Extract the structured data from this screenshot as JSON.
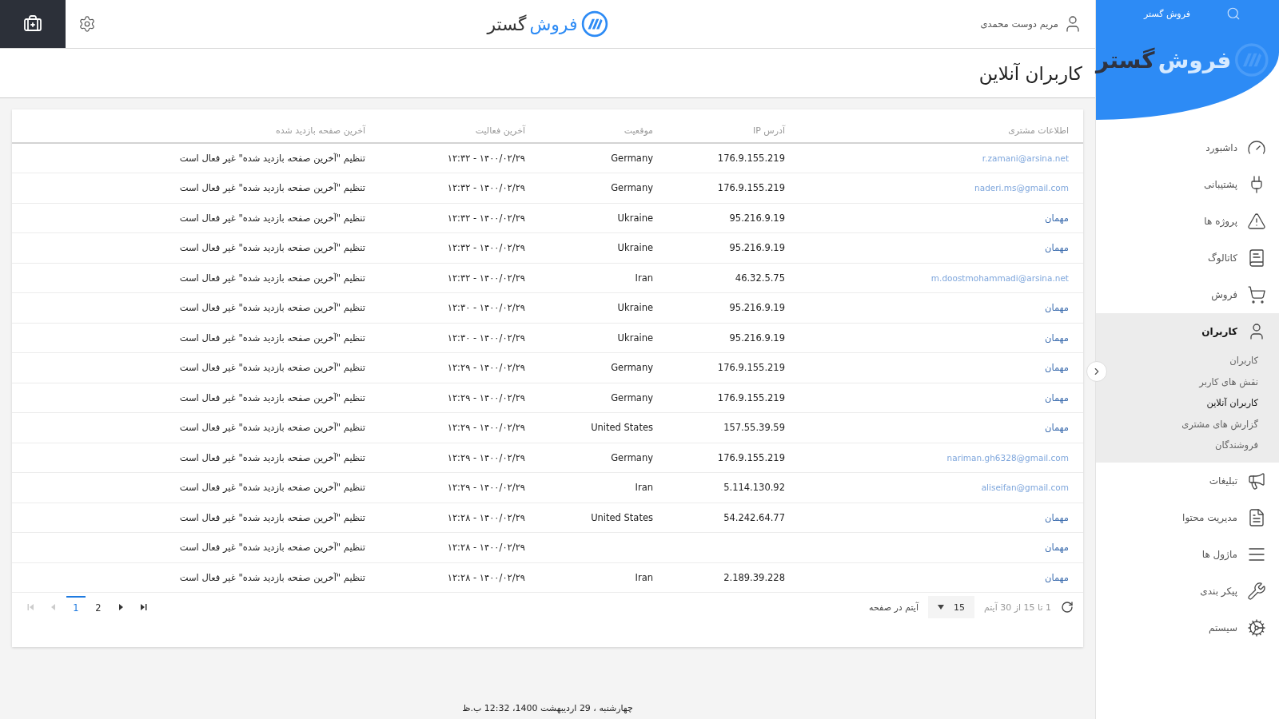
{
  "header": {
    "logo_first": "فروش",
    "logo_second": "گستر",
    "user_name": "مریم دوست محمدی"
  },
  "page_title": "کاربران آنلاین",
  "sidebar": {
    "brand": "فروش گستر",
    "logo_first": "فروش",
    "logo_second": "گستر",
    "items": [
      {
        "label": "داشبورد",
        "selected": false
      },
      {
        "label": "پشتیبانی",
        "selected": false
      },
      {
        "label": "پروژه ها",
        "selected": false
      },
      {
        "label": "کاتالوگ",
        "selected": false
      },
      {
        "label": "فروش",
        "selected": false
      },
      {
        "label": "کاربران",
        "selected": true,
        "expanded": true,
        "children": [
          {
            "label": "کاربران",
            "selected": false
          },
          {
            "label": "نقش های کاربر",
            "selected": false
          },
          {
            "label": "کاربران آنلاین",
            "selected": true
          },
          {
            "label": "گزارش های مشتری",
            "selected": false
          },
          {
            "label": "فروشندگان",
            "selected": false
          }
        ]
      },
      {
        "label": "تبلیغات",
        "selected": false
      },
      {
        "label": "مدیریت محتوا",
        "selected": false
      },
      {
        "label": "ماژول ها",
        "selected": false
      },
      {
        "label": "پیکر بندی",
        "selected": false
      },
      {
        "label": "سیستم",
        "selected": false
      }
    ]
  },
  "table": {
    "columns": [
      "اطلاعات مشتری",
      "آدرس IP",
      "موقعیت",
      "آخرین فعالیت",
      "آخرین صفحه بازدید شده"
    ],
    "rows": [
      {
        "customer": "r.zamani@arsina.net",
        "kind": "email",
        "ip": "176.9.155.219",
        "location": "Germany",
        "last_activity": "۱۴۰۰/۰۲/۲۹ - ۱۲:۳۲",
        "last_page": "تنظیم \"آخرین صفحه بازدید شده\" غیر فعال است"
      },
      {
        "customer": "naderi.ms@gmail.com",
        "kind": "email",
        "ip": "176.9.155.219",
        "location": "Germany",
        "last_activity": "۱۴۰۰/۰۲/۲۹ - ۱۲:۳۲",
        "last_page": "تنظیم \"آخرین صفحه بازدید شده\" غیر فعال است"
      },
      {
        "customer": "مهمان",
        "kind": "guest",
        "ip": "95.216.9.19",
        "location": "Ukraine",
        "last_activity": "۱۴۰۰/۰۲/۲۹ - ۱۲:۳۲",
        "last_page": "تنظیم \"آخرین صفحه بازدید شده\" غیر فعال است"
      },
      {
        "customer": "مهمان",
        "kind": "guest",
        "ip": "95.216.9.19",
        "location": "Ukraine",
        "last_activity": "۱۴۰۰/۰۲/۲۹ - ۱۲:۳۲",
        "last_page": "تنظیم \"آخرین صفحه بازدید شده\" غیر فعال است"
      },
      {
        "customer": "m.doostmohammadi@arsina.net",
        "kind": "email",
        "ip": "46.32.5.75",
        "location": "Iran",
        "last_activity": "۱۴۰۰/۰۲/۲۹ - ۱۲:۳۲",
        "last_page": "تنظیم \"آخرین صفحه بازدید شده\" غیر فعال است"
      },
      {
        "customer": "مهمان",
        "kind": "guest",
        "ip": "95.216.9.19",
        "location": "Ukraine",
        "last_activity": "۱۴۰۰/۰۲/۲۹ - ۱۲:۳۰",
        "last_page": "تنظیم \"آخرین صفحه بازدید شده\" غیر فعال است"
      },
      {
        "customer": "مهمان",
        "kind": "guest",
        "ip": "95.216.9.19",
        "location": "Ukraine",
        "last_activity": "۱۴۰۰/۰۲/۲۹ - ۱۲:۳۰",
        "last_page": "تنظیم \"آخرین صفحه بازدید شده\" غیر فعال است"
      },
      {
        "customer": "مهمان",
        "kind": "guest",
        "ip": "176.9.155.219",
        "location": "Germany",
        "last_activity": "۱۴۰۰/۰۲/۲۹ - ۱۲:۲۹",
        "last_page": "تنظیم \"آخرین صفحه بازدید شده\" غیر فعال است"
      },
      {
        "customer": "مهمان",
        "kind": "guest",
        "ip": "176.9.155.219",
        "location": "Germany",
        "last_activity": "۱۴۰۰/۰۲/۲۹ - ۱۲:۲۹",
        "last_page": "تنظیم \"آخرین صفحه بازدید شده\" غیر فعال است"
      },
      {
        "customer": "مهمان",
        "kind": "guest",
        "ip": "157.55.39.59",
        "location": "United States",
        "last_activity": "۱۴۰۰/۰۲/۲۹ - ۱۲:۲۹",
        "last_page": "تنظیم \"آخرین صفحه بازدید شده\" غیر فعال است"
      },
      {
        "customer": "nariman.gh6328@gmail.com",
        "kind": "email",
        "ip": "176.9.155.219",
        "location": "Germany",
        "last_activity": "۱۴۰۰/۰۲/۲۹ - ۱۲:۲۹",
        "last_page": "تنظیم \"آخرین صفحه بازدید شده\" غیر فعال است"
      },
      {
        "customer": "aliseifan@gmail.com",
        "kind": "email",
        "ip": "5.114.130.92",
        "location": "Iran",
        "last_activity": "۱۴۰۰/۰۲/۲۹ - ۱۲:۲۹",
        "last_page": "تنظیم \"آخرین صفحه بازدید شده\" غیر فعال است"
      },
      {
        "customer": "مهمان",
        "kind": "guest",
        "ip": "54.242.64.77",
        "location": "United States",
        "last_activity": "۱۴۰۰/۰۲/۲۹ - ۱۲:۲۸",
        "last_page": "تنظیم \"آخرین صفحه بازدید شده\" غیر فعال است"
      },
      {
        "customer": "مهمان",
        "kind": "guest",
        "last_activity": "۱۴۰۰/۰۲/۲۹ - ۱۲:۲۸",
        "last_page": "تنظیم \"آخرین صفحه بازدید شده\" غیر فعال است"
      },
      {
        "customer": "مهمان",
        "kind": "guest",
        "ip": "2.189.39.228",
        "location": "Iran",
        "last_activity": "۱۴۰۰/۰۲/۲۹ - ۱۲:۲۸",
        "last_page": "تنظیم \"آخرین صفحه بازدید شده\" غیر فعال است"
      }
    ]
  },
  "pagination": {
    "summary": "1 تا 15 از 30 آیتم",
    "page_size": "15",
    "page_size_label": "آیتم در صفحه",
    "controls": [
      {
        "kind": "last",
        "disabled": false
      },
      {
        "kind": "next",
        "disabled": false
      },
      {
        "kind": "page",
        "label": "2",
        "selected": false
      },
      {
        "kind": "page",
        "label": "1",
        "selected": true
      },
      {
        "kind": "prev",
        "disabled": true
      },
      {
        "kind": "first",
        "disabled": true
      }
    ]
  },
  "footer": "چهارشنبه ، 29 اردیبهشت 1400، 12:32 ب.ظ"
}
